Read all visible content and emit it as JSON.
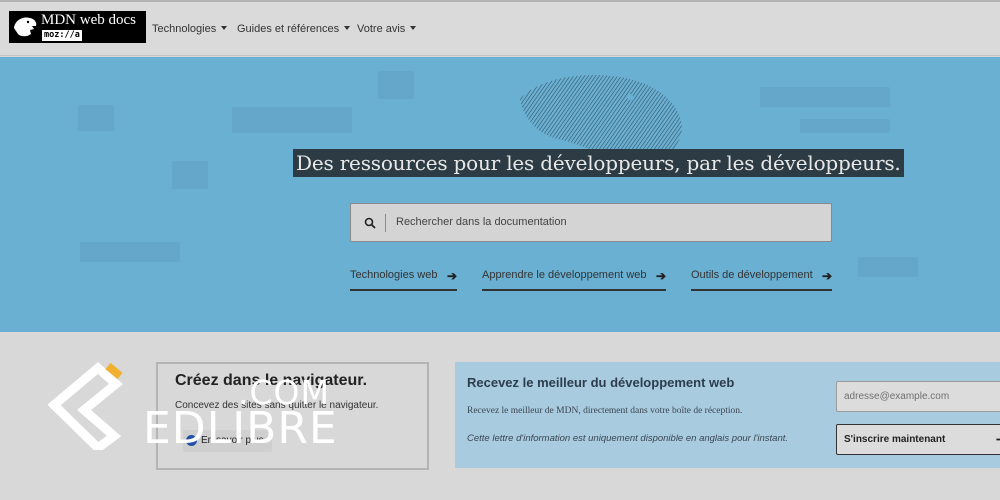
{
  "header": {
    "logo_title": "MDN web docs",
    "logo_sub": "moz://a",
    "nav": [
      {
        "label": "Technologies",
        "icon": "caret-down-icon"
      },
      {
        "label": "Guides et références",
        "icon": "caret-down-icon"
      },
      {
        "label": "Votre avis",
        "icon": "caret-down-icon"
      }
    ]
  },
  "hero": {
    "title": "Des ressources pour les développeurs, par les développeurs.",
    "search": {
      "placeholder": "Rechercher dans la documentation",
      "icon": "search-icon"
    },
    "links": [
      {
        "label": "Technologies web",
        "icon": "arrow-right-icon"
      },
      {
        "label": "Apprendre le développement web",
        "icon": "arrow-right-icon"
      },
      {
        "label": "Outils de développement",
        "icon": "arrow-right-icon"
      }
    ]
  },
  "promo": {
    "title": "Créez dans le navigateur.",
    "text": "Concevez des sites sans quitter le navigateur.",
    "button": "En savoir plus"
  },
  "newsletter": {
    "title": "Recevez le meilleur du développement web",
    "text": "Recevez le meilleur de MDN, directement dans votre boîte de réception.",
    "note": "Cette lettre d'information est uniquement disponible en anglais pour l'instant.",
    "email_placeholder": "adresse@example.com",
    "signup_label": "S'inscrire maintenant",
    "signup_icon": "arrow-right-icon"
  },
  "watermark": {
    "com": ".COM",
    "name": "EDLIBRE"
  },
  "colors": {
    "hero_bg": "#6ab0d3",
    "page_bg": "#d8d8d8",
    "newsletter_bg": "#a9cbe0",
    "title_bg": "#2c3b44"
  }
}
